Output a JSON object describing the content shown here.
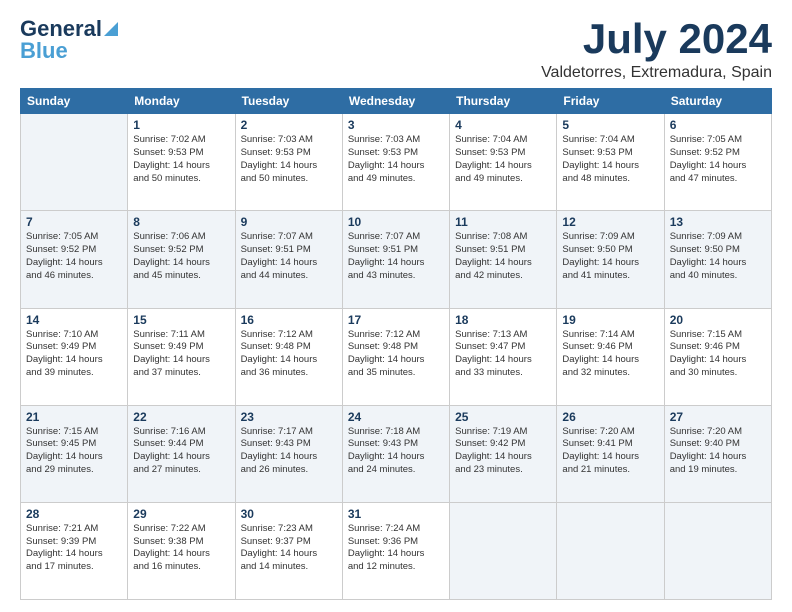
{
  "logo": {
    "line1": "General",
    "line2": "Blue"
  },
  "header": {
    "month": "July 2024",
    "location": "Valdetorres, Extremadura, Spain"
  },
  "weekdays": [
    "Sunday",
    "Monday",
    "Tuesday",
    "Wednesday",
    "Thursday",
    "Friday",
    "Saturday"
  ],
  "weeks": [
    [
      {
        "day": "",
        "info": ""
      },
      {
        "day": "1",
        "info": "Sunrise: 7:02 AM\nSunset: 9:53 PM\nDaylight: 14 hours\nand 50 minutes."
      },
      {
        "day": "2",
        "info": "Sunrise: 7:03 AM\nSunset: 9:53 PM\nDaylight: 14 hours\nand 50 minutes."
      },
      {
        "day": "3",
        "info": "Sunrise: 7:03 AM\nSunset: 9:53 PM\nDaylight: 14 hours\nand 49 minutes."
      },
      {
        "day": "4",
        "info": "Sunrise: 7:04 AM\nSunset: 9:53 PM\nDaylight: 14 hours\nand 49 minutes."
      },
      {
        "day": "5",
        "info": "Sunrise: 7:04 AM\nSunset: 9:53 PM\nDaylight: 14 hours\nand 48 minutes."
      },
      {
        "day": "6",
        "info": "Sunrise: 7:05 AM\nSunset: 9:52 PM\nDaylight: 14 hours\nand 47 minutes."
      }
    ],
    [
      {
        "day": "7",
        "info": "Sunrise: 7:05 AM\nSunset: 9:52 PM\nDaylight: 14 hours\nand 46 minutes."
      },
      {
        "day": "8",
        "info": "Sunrise: 7:06 AM\nSunset: 9:52 PM\nDaylight: 14 hours\nand 45 minutes."
      },
      {
        "day": "9",
        "info": "Sunrise: 7:07 AM\nSunset: 9:51 PM\nDaylight: 14 hours\nand 44 minutes."
      },
      {
        "day": "10",
        "info": "Sunrise: 7:07 AM\nSunset: 9:51 PM\nDaylight: 14 hours\nand 43 minutes."
      },
      {
        "day": "11",
        "info": "Sunrise: 7:08 AM\nSunset: 9:51 PM\nDaylight: 14 hours\nand 42 minutes."
      },
      {
        "day": "12",
        "info": "Sunrise: 7:09 AM\nSunset: 9:50 PM\nDaylight: 14 hours\nand 41 minutes."
      },
      {
        "day": "13",
        "info": "Sunrise: 7:09 AM\nSunset: 9:50 PM\nDaylight: 14 hours\nand 40 minutes."
      }
    ],
    [
      {
        "day": "14",
        "info": "Sunrise: 7:10 AM\nSunset: 9:49 PM\nDaylight: 14 hours\nand 39 minutes."
      },
      {
        "day": "15",
        "info": "Sunrise: 7:11 AM\nSunset: 9:49 PM\nDaylight: 14 hours\nand 37 minutes."
      },
      {
        "day": "16",
        "info": "Sunrise: 7:12 AM\nSunset: 9:48 PM\nDaylight: 14 hours\nand 36 minutes."
      },
      {
        "day": "17",
        "info": "Sunrise: 7:12 AM\nSunset: 9:48 PM\nDaylight: 14 hours\nand 35 minutes."
      },
      {
        "day": "18",
        "info": "Sunrise: 7:13 AM\nSunset: 9:47 PM\nDaylight: 14 hours\nand 33 minutes."
      },
      {
        "day": "19",
        "info": "Sunrise: 7:14 AM\nSunset: 9:46 PM\nDaylight: 14 hours\nand 32 minutes."
      },
      {
        "day": "20",
        "info": "Sunrise: 7:15 AM\nSunset: 9:46 PM\nDaylight: 14 hours\nand 30 minutes."
      }
    ],
    [
      {
        "day": "21",
        "info": "Sunrise: 7:15 AM\nSunset: 9:45 PM\nDaylight: 14 hours\nand 29 minutes."
      },
      {
        "day": "22",
        "info": "Sunrise: 7:16 AM\nSunset: 9:44 PM\nDaylight: 14 hours\nand 27 minutes."
      },
      {
        "day": "23",
        "info": "Sunrise: 7:17 AM\nSunset: 9:43 PM\nDaylight: 14 hours\nand 26 minutes."
      },
      {
        "day": "24",
        "info": "Sunrise: 7:18 AM\nSunset: 9:43 PM\nDaylight: 14 hours\nand 24 minutes."
      },
      {
        "day": "25",
        "info": "Sunrise: 7:19 AM\nSunset: 9:42 PM\nDaylight: 14 hours\nand 23 minutes."
      },
      {
        "day": "26",
        "info": "Sunrise: 7:20 AM\nSunset: 9:41 PM\nDaylight: 14 hours\nand 21 minutes."
      },
      {
        "day": "27",
        "info": "Sunrise: 7:20 AM\nSunset: 9:40 PM\nDaylight: 14 hours\nand 19 minutes."
      }
    ],
    [
      {
        "day": "28",
        "info": "Sunrise: 7:21 AM\nSunset: 9:39 PM\nDaylight: 14 hours\nand 17 minutes."
      },
      {
        "day": "29",
        "info": "Sunrise: 7:22 AM\nSunset: 9:38 PM\nDaylight: 14 hours\nand 16 minutes."
      },
      {
        "day": "30",
        "info": "Sunrise: 7:23 AM\nSunset: 9:37 PM\nDaylight: 14 hours\nand 14 minutes."
      },
      {
        "day": "31",
        "info": "Sunrise: 7:24 AM\nSunset: 9:36 PM\nDaylight: 14 hours\nand 12 minutes."
      },
      {
        "day": "",
        "info": ""
      },
      {
        "day": "",
        "info": ""
      },
      {
        "day": "",
        "info": ""
      }
    ]
  ]
}
